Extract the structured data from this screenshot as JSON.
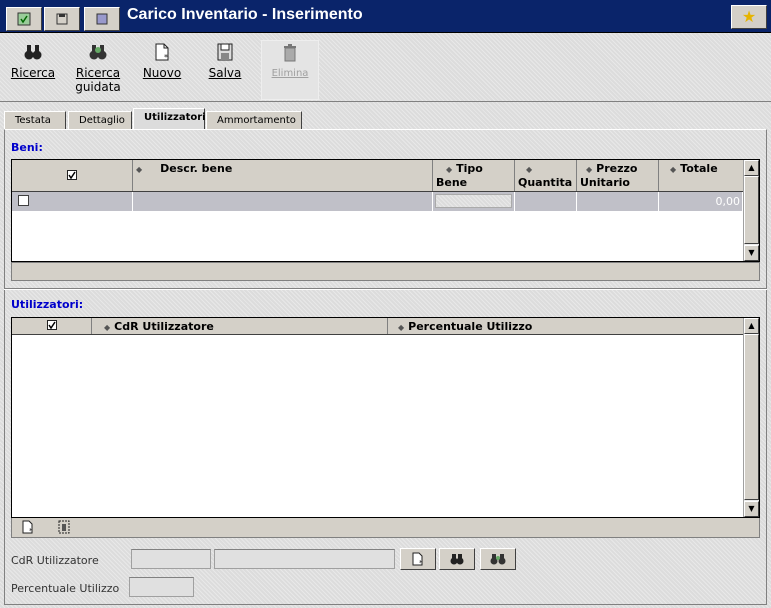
{
  "window": {
    "title": "Carico Inventario - Inserimento"
  },
  "toolbar": {
    "ricerca": "Ricerca",
    "ricerca_guidata_1": "Ricerca",
    "ricerca_guidata_2": "guidata",
    "nuovo": "Nuovo",
    "salva": "Salva",
    "elimina": "Elimina"
  },
  "tabs": [
    "Testata",
    "Dettaglio",
    "Utilizzatori",
    "Ammortamento"
  ],
  "beni": {
    "label": "Beni:",
    "columns": [
      "Descr. bene",
      "Tipo",
      "Bene",
      "Quantita",
      "Prezzo",
      "Unitario",
      "Totale"
    ],
    "row": {
      "totale": "0,00"
    }
  },
  "utilizzatori": {
    "label": "Utilizzatori:",
    "columns": [
      "CdR Utilizzatore",
      "Percentuale Utilizzo"
    ]
  },
  "form": {
    "cdr_label": "CdR Utilizzatore",
    "perc_label": "Percentuale Utilizzo"
  },
  "colors": {
    "titlebar": "#0a246a",
    "section_label": "#0000cc",
    "selected_row": "#c0c0c8"
  }
}
